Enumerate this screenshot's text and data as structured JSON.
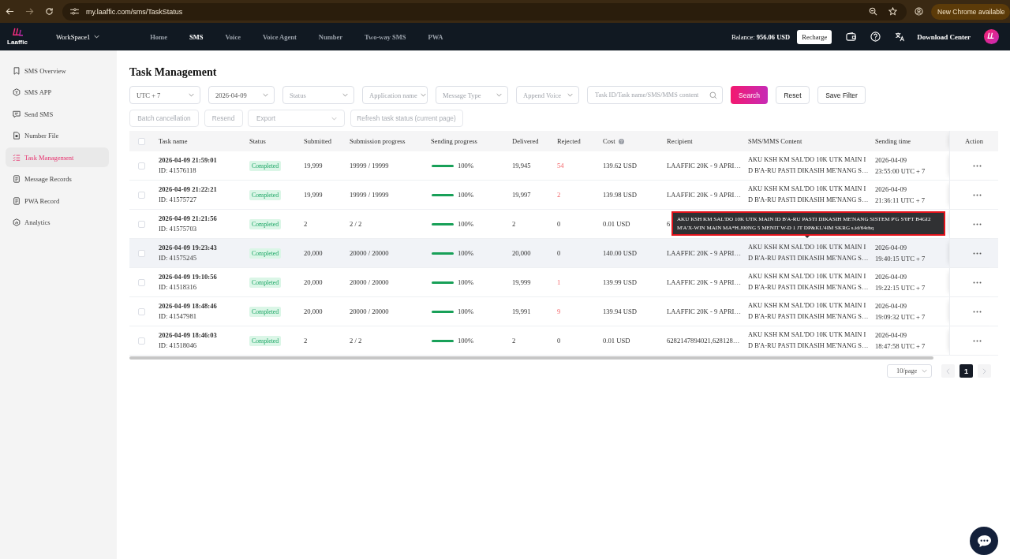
{
  "browser": {
    "url": "my.laaffic.com/sms/TaskStatus",
    "update_button": "New Chrome available"
  },
  "header": {
    "logo_text": "Laaffic",
    "workspace": "WorkSpace1",
    "nav": [
      {
        "label": "Home",
        "selected": false
      },
      {
        "label": "SMS",
        "selected": true
      },
      {
        "label": "Voice",
        "selected": false
      },
      {
        "label": "Voice Agent",
        "selected": false
      },
      {
        "label": "Number",
        "selected": false
      },
      {
        "label": "Two-way SMS",
        "selected": false
      },
      {
        "label": "PWA",
        "selected": false
      }
    ],
    "balance_label": "Balance:",
    "balance_value": "956.06 USD",
    "recharge_button": "Recharge",
    "download_center": "Download Center"
  },
  "sidebar": {
    "items": [
      {
        "label": "SMS Overview",
        "selected": false
      },
      {
        "label": "SMS APP",
        "selected": false
      },
      {
        "label": "Send SMS",
        "selected": false
      },
      {
        "label": "Number File",
        "selected": false
      },
      {
        "label": "Task Management",
        "selected": true
      },
      {
        "label": "Message Records",
        "selected": false
      },
      {
        "label": "PWA Record",
        "selected": false
      },
      {
        "label": "Analytics",
        "selected": false
      }
    ]
  },
  "page": {
    "title": "Task Management"
  },
  "filters": {
    "selects": [
      {
        "value": "UTC + 7"
      },
      {
        "value": "2026-04-09"
      },
      {
        "placeholder": "Status"
      },
      {
        "placeholder": "Application name"
      },
      {
        "placeholder": "Message Type"
      },
      {
        "placeholder": "Append Voice"
      }
    ],
    "search": {
      "placeholder": "Task ID/Task name/SMS/MMS content"
    },
    "buttons": [
      {
        "label": "Search",
        "kind": "primary"
      },
      {
        "label": "Reset",
        "kind": "default"
      },
      {
        "label": "Save Filter",
        "kind": "default"
      }
    ]
  },
  "actions": [
    {
      "label": "Batch cancellation",
      "kind": "button",
      "disabled": true
    },
    {
      "label": "Resend",
      "kind": "button",
      "disabled": true
    },
    {
      "label": "Export",
      "kind": "select",
      "disabled": true
    },
    {
      "label": "Refresh task status (current page)",
      "kind": "button",
      "disabled": true
    }
  ],
  "table": {
    "select_all": {
      "checked": false
    },
    "columns": [
      {
        "label": "Task name",
        "info": false
      },
      {
        "label": "Status",
        "info": false
      },
      {
        "label": "Submitted",
        "info": false
      },
      {
        "label": "Submission progress",
        "info": false
      },
      {
        "label": "Sending progress",
        "info": false
      },
      {
        "label": "Delivered",
        "info": false
      },
      {
        "label": "Rejected",
        "info": false
      },
      {
        "label": "Cost",
        "info": true
      },
      {
        "label": "Recipient",
        "info": false
      },
      {
        "label": "SMS/MMS Content",
        "info": false
      },
      {
        "label": "Sending time",
        "info": false
      },
      {
        "label": "Action",
        "info": false
      }
    ],
    "rows": [
      {
        "checked": false,
        "hovered": false,
        "task_time": "2026-04-09 21:59:01",
        "task_id": "ID: 41576118",
        "status": "Completed",
        "submitted": "19,999",
        "submission_progress": "19999 / 19999",
        "level": 1,
        "progress_text": "100%",
        "delivered": "19,945",
        "rejected": "54",
        "rejected_alert": true,
        "cost": "139.62 USD",
        "recipient": "LAAFFIC 20K - 9 APRI…",
        "content": "AKU KSH KM SAL'DO 10K UTK MAIN ID B'A-RU PASTI DIKASIH ME'NANG S…",
        "sending_time": "2026-04-09 23:55:00 UTC + 7"
      },
      {
        "checked": false,
        "hovered": false,
        "task_time": "2026-04-09 21:22:21",
        "task_id": "ID: 41575727",
        "status": "Completed",
        "submitted": "19,999",
        "submission_progress": "19999 / 19999",
        "level": 1,
        "progress_text": "100%",
        "delivered": "19,997",
        "rejected": "2",
        "rejected_alert": true,
        "cost": "139.98 USD",
        "recipient": "LAAFFIC 20K - 9 APRI…",
        "content": "AKU KSH KM SAL'DO 10K UTK MAIN ID B'A-RU PASTI DIKASIH ME'NANG S…",
        "sending_time": "2026-04-09 21:36:11 UTC + 7"
      },
      {
        "checked": false,
        "hovered": false,
        "task_time": "2026-04-09 21:21:56",
        "task_id": "ID: 41575703",
        "status": "Completed",
        "submitted": "2",
        "submission_progress": "2 / 2",
        "level": 1,
        "progress_text": "100%",
        "delivered": "2",
        "rejected": "0",
        "rejected_alert": false,
        "cost": "0.01 USD",
        "recipient": "6"
      },
      {
        "checked": false,
        "hovered": true,
        "task_time": "2026-04-09 19:23:43",
        "task_id": "ID: 41575245",
        "status": "Completed",
        "submitted": "20,000",
        "submission_progress": "20000 / 20000",
        "level": 1,
        "progress_text": "100%",
        "delivered": "20,000",
        "rejected": "0",
        "rejected_alert": false,
        "cost": "140.00 USD",
        "recipient": "LAAFFIC 20K - 9 APRI…",
        "content": "AKU KSH KM SAL'DO 10K UTK MAIN ID B'A-RU PASTI DIKASIH ME'NANG S…",
        "sending_time": "2026-04-09 19:40:15 UTC + 7",
        "tooltip": {
          "text": "AKU KSH KM SAL'DO 10K UTK MAIN ID B'A-RU PASTI DIKASIH ME'NANG SISTEM P'G S'0FT B4GI2 M'A'X-WIN MAIN MA*H.J00NG 5 MENIT W-D 1 JT DP&KL'4IM SKRG s.id/64rhq",
          "outlined": true
        }
      },
      {
        "checked": false,
        "hovered": false,
        "task_time": "2026-04-09 19:10:56",
        "task_id": "ID: 41518316",
        "status": "Completed",
        "submitted": "20,000",
        "submission_progress": "20000 / 20000",
        "level": 1,
        "progress_text": "100%",
        "delivered": "19,999",
        "rejected": "1",
        "rejected_alert": true,
        "cost": "139.99 USD",
        "recipient": "LAAFFIC 20K - 9 APRI…",
        "content": "AKU KSH KM SAL'DO 10K UTK MAIN ID B'A-RU PASTI DIKASIH ME'NANG S…",
        "sending_time": "2026-04-09 19:22:15 UTC + 7"
      },
      {
        "checked": false,
        "hovered": false,
        "task_time": "2026-04-09 18:48:46",
        "task_id": "ID: 41547981",
        "status": "Completed",
        "submitted": "20,000",
        "submission_progress": "20000 / 20000",
        "level": 1,
        "progress_text": "100%",
        "delivered": "19,991",
        "rejected": "9",
        "rejected_alert": true,
        "cost": "139.94 USD",
        "recipient": "LAAFFIC 20K - 9 APRI…",
        "content": "AKU KSH KM SAL'DO 10K UTK MAIN ID B'A-RU PASTI DIKASIH ME'NANG S…",
        "sending_time": "2026-04-09 19:09:32 UTC + 7"
      },
      {
        "checked": false,
        "hovered": false,
        "task_time": "2026-04-09 18:46:03",
        "task_id": "ID: 41518046",
        "status": "Completed",
        "submitted": "2",
        "submission_progress": "2 / 2",
        "level": 1,
        "progress_text": "100%",
        "delivered": "2",
        "rejected": "0",
        "rejected_alert": false,
        "cost": "0.01 USD",
        "recipient": "6282147894021,628128…",
        "content": "AKU KSH KM SAL'DO 10K UTK MAIN ID B'A-RU PASTI DIKASIH ME'NANG S…",
        "sending_time": "2026-04-09 18:47:58 UTC + 7"
      }
    ]
  },
  "pagination": {
    "page_size": "10/page",
    "prev_disabled": true,
    "pages": [
      {
        "label": "1",
        "selected": true
      }
    ],
    "next_disabled": true
  }
}
